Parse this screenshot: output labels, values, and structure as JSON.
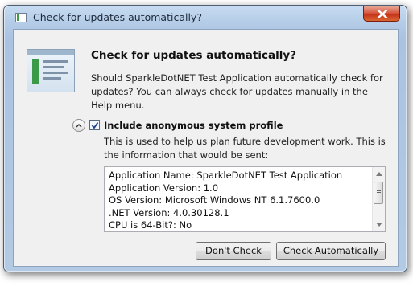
{
  "window": {
    "title": "Check for updates automatically?",
    "icon": "app-window-icon",
    "close_icon": "close-icon"
  },
  "content": {
    "app_icon": "update-app-icon",
    "heading": "Check for updates automatically?",
    "description": "Should SparkleDotNET Test Application automatically check for updates? You can always check for updates manually in the Help menu."
  },
  "profile": {
    "expanded": true,
    "expander_icon": "chevron-up-icon",
    "checkbox_checked": true,
    "checkbox_label": "Include anonymous system profile",
    "info": "This is used to help us plan future development work. This is the information that would be sent:",
    "lines": [
      "Application Name: SparkleDotNET Test Application",
      "Application Version: 1.0",
      "OS Version: Microsoft Windows NT 6.1.7600.0",
      ".NET Version: 4.0.30128.1",
      "CPU is 64-Bit?: No"
    ]
  },
  "buttons": {
    "dont_check": "Don't Check",
    "check_automatically": "Check Automatically"
  },
  "colors": {
    "accent_green": "#3f9f3f",
    "close_red": "#c5331b",
    "frame_blue": "#b6cde8"
  }
}
